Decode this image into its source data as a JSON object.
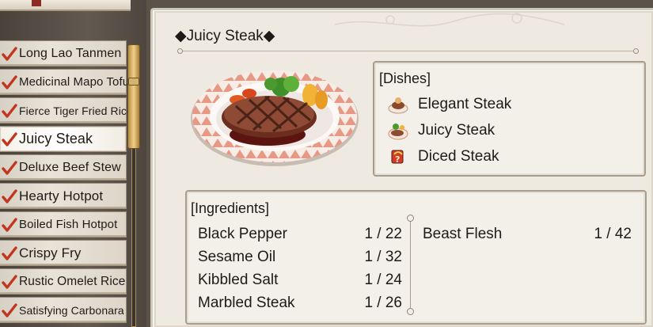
{
  "recipe_list": {
    "items": [
      {
        "label": "Long Lao Tanmen",
        "done": true
      },
      {
        "label": "Medicinal Mapo Tofu",
        "done": true
      },
      {
        "label": "Fierce Tiger Fried Rice",
        "done": true
      },
      {
        "label": "Juicy Steak",
        "done": true,
        "selected": true
      },
      {
        "label": "Deluxe Beef Stew",
        "done": true
      },
      {
        "label": "Hearty Hotpot",
        "done": true
      },
      {
        "label": "Boiled Fish Hotpot",
        "done": true
      },
      {
        "label": "Crispy Fry",
        "done": true
      },
      {
        "label": "Rustic Omelet Rice",
        "done": true
      },
      {
        "label": "Satisfying Carbonara",
        "done": true
      }
    ],
    "check_icon": "check-mark-icon",
    "check_color": "#c2361f"
  },
  "detail": {
    "title": "◆Juicy Steak◆",
    "dish_image": "juicy-steak-plate-image",
    "dishes_heading": "[Dishes]",
    "dishes": [
      {
        "name": "Elegant Steak",
        "icon": "elegant-steak-icon"
      },
      {
        "name": "Juicy Steak",
        "icon": "juicy-steak-icon"
      },
      {
        "name": "Diced Steak",
        "icon": "diced-steak-icon"
      }
    ],
    "ingredients_heading": "[Ingredients]",
    "ingredients_left": [
      {
        "name": "Black Pepper",
        "qty": "1 / 22"
      },
      {
        "name": "Sesame Oil",
        "qty": "1 / 32"
      },
      {
        "name": "Kibbled Salt",
        "qty": "1 / 24"
      },
      {
        "name": "Marbled Steak",
        "qty": "1 / 26"
      }
    ],
    "ingredients_right": [
      {
        "name": "Beast Flesh",
        "qty": "1 / 42"
      }
    ]
  }
}
